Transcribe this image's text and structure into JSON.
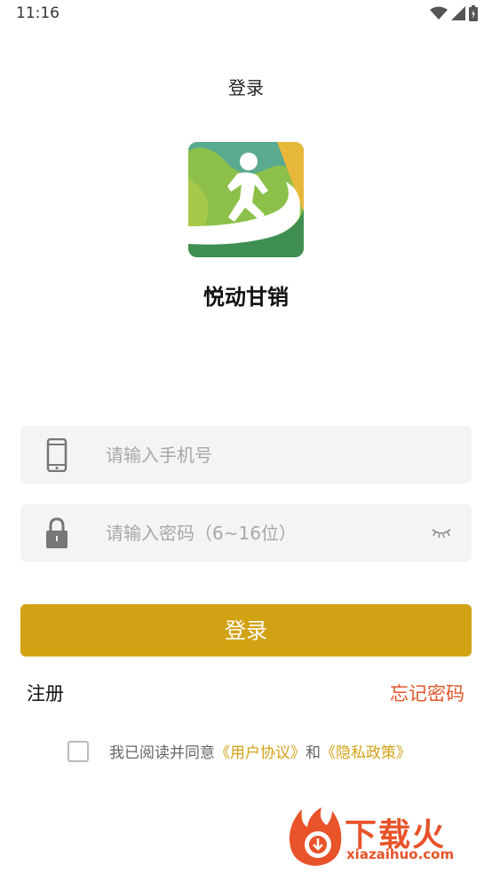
{
  "status_bar": {
    "time": "11:16"
  },
  "header": {
    "title": "登录"
  },
  "app": {
    "name": "悦动甘销"
  },
  "form": {
    "phone_placeholder": "请输入手机号",
    "password_placeholder": "请输入密码（6~16位）",
    "login_label": "登录",
    "register_label": "注册",
    "forgot_label": "忘记密码"
  },
  "agreement": {
    "prefix": "我已阅读并同意",
    "user_agreement": "《用户协议》",
    "conjunction": "和",
    "privacy_policy": "《隐私政策》",
    "checked": false
  },
  "watermark": {
    "brand": "下载火",
    "url": "xiazaihuo.com"
  },
  "colors": {
    "accent": "#d2a215",
    "link_orange": "#e0562a",
    "field_bg": "#f4f4f4"
  },
  "icons": [
    "wifi-icon",
    "signal-icon",
    "battery-icon",
    "phone-icon",
    "lock-icon",
    "eye-closed-icon",
    "checkbox-icon"
  ]
}
